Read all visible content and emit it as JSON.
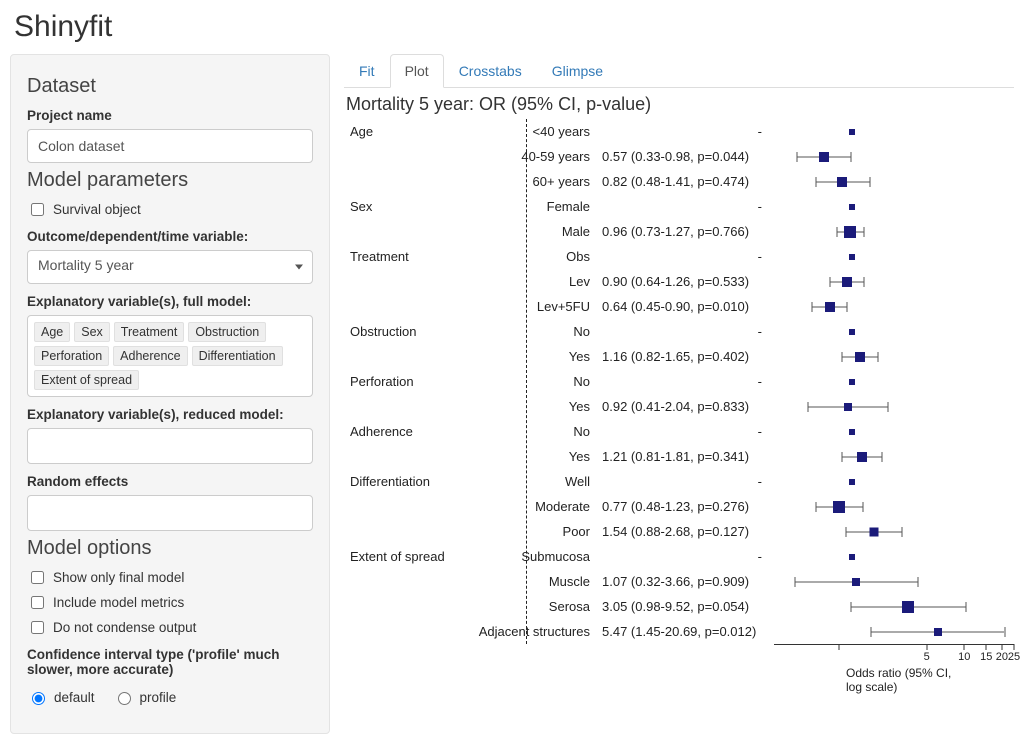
{
  "app_title": "Shinyfit",
  "sidebar": {
    "dataset_heading": "Dataset",
    "project_name_label": "Project name",
    "project_name_value": "Colon dataset",
    "model_params_heading": "Model parameters",
    "survival_object_label": "Survival object",
    "outcome_label": "Outcome/dependent/time variable:",
    "outcome_value": "Mortality 5 year",
    "explanatory_full_label": "Explanatory variable(s), full model:",
    "explanatory_full_tokens": [
      "Age",
      "Sex",
      "Treatment",
      "Obstruction",
      "Perforation",
      "Adherence",
      "Differentiation",
      "Extent of spread"
    ],
    "explanatory_reduced_label": "Explanatory variable(s), reduced model:",
    "random_effects_label": "Random effects",
    "model_options_heading": "Model options",
    "opt_show_final_label": "Show only final model",
    "opt_include_metrics_label": "Include model metrics",
    "opt_no_condense_label": "Do not condense output",
    "ci_type_label": "Confidence interval type ('profile' much slower, more accurate)",
    "ci_radio": {
      "default": "default",
      "profile": "profile",
      "selected": "default"
    }
  },
  "tabs": {
    "fit": "Fit",
    "plot": "Plot",
    "crosstabs": "Crosstabs",
    "glimpse": "Glimpse",
    "active": "plot"
  },
  "plot_title": "Mortality 5 year: OR (95% CI, p-value)",
  "axis": {
    "ticks": [
      1,
      5,
      10,
      15,
      20,
      25
    ],
    "tick_labels": [
      "",
      "5",
      "10",
      "15",
      "20 25"
    ],
    "title": "Odds ratio (95% CI, log scale)"
  },
  "chart_data": {
    "type": "forest",
    "xlabel": "Odds ratio (95% CI, log scale)",
    "x_scale": "log",
    "x_range": [
      0.3,
      25
    ],
    "reference_line": 1,
    "rows": [
      {
        "group": "Age",
        "level": "<40 years",
        "ref": true
      },
      {
        "level": "40-59 years",
        "or": 0.57,
        "lo": 0.33,
        "hi": 0.98,
        "p": "0.044",
        "stat": "0.57 (0.33-0.98, p=0.044)",
        "size": 10
      },
      {
        "level": "60+ years",
        "or": 0.82,
        "lo": 0.48,
        "hi": 1.41,
        "p": "0.474",
        "stat": "0.82 (0.48-1.41, p=0.474)",
        "size": 10
      },
      {
        "group": "Sex",
        "level": "Female",
        "ref": true
      },
      {
        "level": "Male",
        "or": 0.96,
        "lo": 0.73,
        "hi": 1.27,
        "p": "0.766",
        "stat": "0.96 (0.73-1.27, p=0.766)",
        "size": 12
      },
      {
        "group": "Treatment",
        "level": "Obs",
        "ref": true
      },
      {
        "level": "Lev",
        "or": 0.9,
        "lo": 0.64,
        "hi": 1.26,
        "p": "0.533",
        "stat": "0.90 (0.64-1.26, p=0.533)",
        "size": 10
      },
      {
        "level": "Lev+5FU",
        "or": 0.64,
        "lo": 0.45,
        "hi": 0.9,
        "p": "0.010",
        "stat": "0.64 (0.45-0.90, p=0.010)",
        "size": 10
      },
      {
        "group": "Obstruction",
        "level": "No",
        "ref": true
      },
      {
        "level": "Yes",
        "or": 1.16,
        "lo": 0.82,
        "hi": 1.65,
        "p": "0.402",
        "stat": "1.16 (0.82-1.65, p=0.402)",
        "size": 10
      },
      {
        "group": "Perforation",
        "level": "No",
        "ref": true
      },
      {
        "level": "Yes",
        "or": 0.92,
        "lo": 0.41,
        "hi": 2.04,
        "p": "0.833",
        "stat": "0.92 (0.41-2.04, p=0.833)",
        "size": 8
      },
      {
        "group": "Adherence",
        "level": "No",
        "ref": true
      },
      {
        "level": "Yes",
        "or": 1.21,
        "lo": 0.81,
        "hi": 1.81,
        "p": "0.341",
        "stat": "1.21 (0.81-1.81, p=0.341)",
        "size": 10
      },
      {
        "group": "Differentiation",
        "level": "Well",
        "ref": true
      },
      {
        "level": "Moderate",
        "or": 0.77,
        "lo": 0.48,
        "hi": 1.23,
        "p": "0.276",
        "stat": "0.77 (0.48-1.23, p=0.276)",
        "size": 12
      },
      {
        "level": "Poor",
        "or": 1.54,
        "lo": 0.88,
        "hi": 2.68,
        "p": "0.127",
        "stat": "1.54 (0.88-2.68, p=0.127)",
        "size": 9
      },
      {
        "group": "Extent of spread",
        "level": "Submucosa",
        "ref": true
      },
      {
        "level": "Muscle",
        "or": 1.07,
        "lo": 0.32,
        "hi": 3.66,
        "p": "0.909",
        "stat": "1.07 (0.32-3.66, p=0.909)",
        "size": 8
      },
      {
        "level": "Serosa",
        "or": 3.05,
        "lo": 0.98,
        "hi": 9.52,
        "p": "0.054",
        "stat": "3.05 (0.98-9.52, p=0.054)",
        "size": 12
      },
      {
        "level": "Adjacent structures",
        "or": 5.47,
        "lo": 1.45,
        "hi": 20.69,
        "p": "0.012",
        "stat": "5.47 (1.45-20.69, p=0.012)",
        "size": 8
      }
    ]
  }
}
